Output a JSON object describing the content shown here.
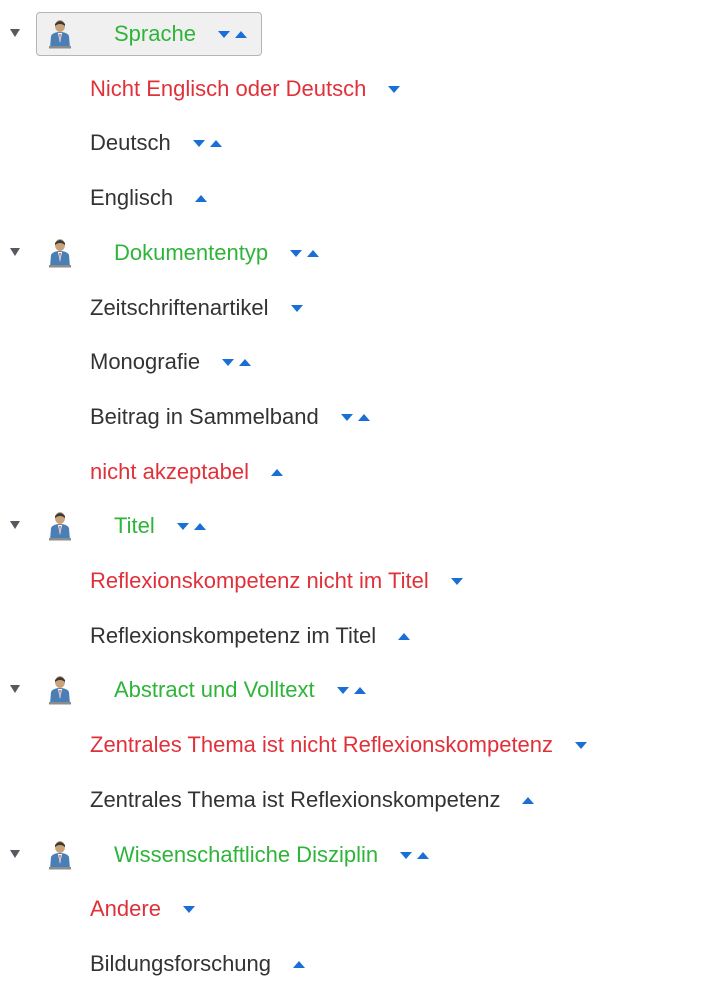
{
  "colors": {
    "category": "#2fb43a",
    "rejected": "#e0313a",
    "default": "#333333",
    "arrow": "#1a6fd6",
    "selected_bg": "#f0f0f0"
  },
  "categories": [
    {
      "label": "Sprache",
      "selected": true,
      "icon": "person-icon",
      "arrows": [
        "down",
        "up"
      ],
      "codes": [
        {
          "label": "Nicht Englisch oder Deutsch",
          "rejected": true,
          "arrows": [
            "down"
          ]
        },
        {
          "label": "Deutsch",
          "rejected": false,
          "arrows": [
            "down",
            "up"
          ]
        },
        {
          "label": "Englisch",
          "rejected": false,
          "arrows": [
            "up"
          ]
        }
      ]
    },
    {
      "label": "Dokumententyp",
      "selected": false,
      "icon": "person-icon",
      "arrows": [
        "down",
        "up"
      ],
      "codes": [
        {
          "label": "Zeitschriftenartikel",
          "rejected": false,
          "arrows": [
            "down"
          ]
        },
        {
          "label": "Monografie",
          "rejected": false,
          "arrows": [
            "down",
            "up"
          ]
        },
        {
          "label": "Beitrag in Sammelband",
          "rejected": false,
          "arrows": [
            "down",
            "up"
          ]
        },
        {
          "label": "nicht akzeptabel",
          "rejected": true,
          "arrows": [
            "up"
          ]
        }
      ]
    },
    {
      "label": "Titel",
      "selected": false,
      "icon": "person-icon",
      "arrows": [
        "down",
        "up"
      ],
      "codes": [
        {
          "label": "Reflexionskompetenz nicht im Titel",
          "rejected": true,
          "arrows": [
            "down"
          ]
        },
        {
          "label": "Reflexionskompetenz im Titel",
          "rejected": false,
          "arrows": [
            "up"
          ]
        }
      ]
    },
    {
      "label": "Abstract und Volltext",
      "selected": false,
      "icon": "person-icon",
      "arrows": [
        "down",
        "up"
      ],
      "codes": [
        {
          "label": "Zentrales Thema ist nicht Reflexionskompetenz",
          "rejected": true,
          "arrows": [
            "down"
          ]
        },
        {
          "label": "Zentrales Thema ist Reflexionskompetenz",
          "rejected": false,
          "arrows": [
            "up"
          ]
        }
      ]
    },
    {
      "label": "Wissenschaftliche Disziplin",
      "selected": false,
      "icon": "person-icon",
      "arrows": [
        "down",
        "up"
      ],
      "codes": [
        {
          "label": "Andere",
          "rejected": true,
          "arrows": [
            "down"
          ]
        },
        {
          "label": "Bildungsforschung",
          "rejected": false,
          "arrows": [
            "up"
          ]
        }
      ]
    }
  ]
}
